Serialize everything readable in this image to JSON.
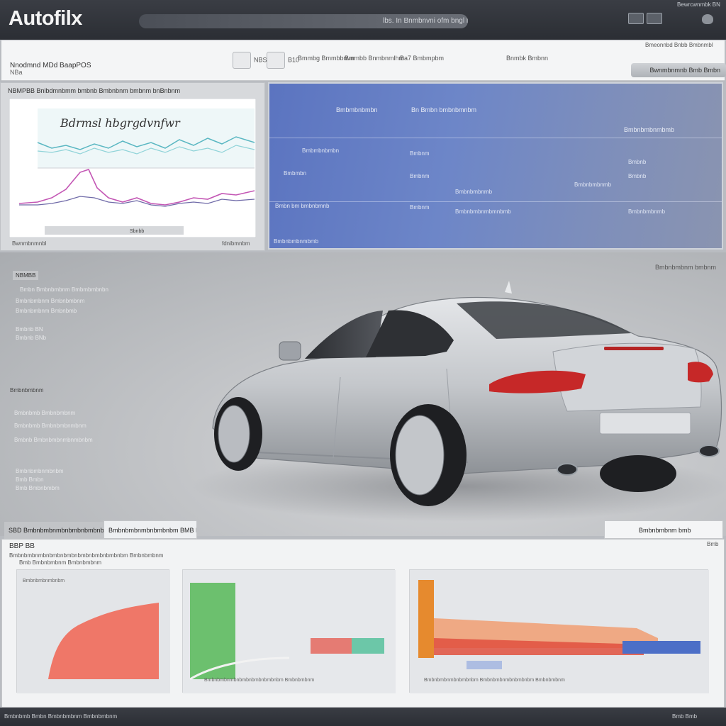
{
  "app": {
    "logo": "Autofilx",
    "search_text": "lbs. In Bnmbnvni ofm bngl hnmf",
    "top_right": "Bewrcwnmbk BN"
  },
  "subheader": {
    "title": "Nnodmnd MDd BaapPOS",
    "subtitle": "NBa",
    "groups": [
      {
        "label": "NBSS"
      },
      {
        "label": "B10"
      },
      {
        "label": "Bmmbg Bmmbbnvm"
      },
      {
        "label": "Bmmbb Bnmbnmlhm"
      },
      {
        "label": "Ba7 Bmbmpbm"
      },
      {
        "label": "Bnmbk Bmbnn"
      }
    ],
    "right_text": "Bmeonnbd Bnbb Bmbnmbl",
    "button": "Bwnmbnmnb Bmb Bmbn"
  },
  "left_panel": {
    "title": "NBMPBB Bnlbdmnbmm bmbnb Bmbnbnm bmbnm bnBnbnm",
    "chart_title": "Bdrmsl hbgrgdvnfwr",
    "tab": "Sbnbb",
    "footer_left": "Bwnmbnmnbl",
    "footer_right": "fdnibmnbm"
  },
  "right_panel": {
    "headers": [
      "Bmbmbnbmbn",
      "Bn Bmbn bmbnbmnbm",
      "Bmbnbmbnmbmb"
    ],
    "rows": [
      [
        "Bmbmbnbmbn",
        "Bmbnm",
        "Bmbnbmbnmb",
        "Bmbnb"
      ],
      [
        "Bmbmbn",
        "Bmbnm",
        "Bmbnbmbnmb",
        "Bmbnb"
      ],
      [
        "Bmbn bm bmbnbmnb",
        "Bmbnm",
        "Bmbnbmbnmbmnbmb",
        "Bmbnbmbnmb"
      ]
    ],
    "footer": "Bmbnbmbnmbmb"
  },
  "car_info": {
    "label_top": "NBMBB",
    "lines_a": [
      "Bmbn Bmbnbmbnm Bmbmbmbnbn",
      "Bmbnbmbnm Bmbnbmbnm",
      "Bmbnbmbnm Bmbnbmb",
      "Bmbnb BN",
      "Bmbnb BNb"
    ],
    "label_mid": "Bmbnbmbnm",
    "lines_b": [
      "Bmbnbmb Bmbnbmbnm",
      "Bmbnbmb Bmbnbmbnmbnm",
      "Bmbnb Bmbnbmbnmbnmbnbm"
    ],
    "lines_c": [
      "Bmbnbmbnmbnbm",
      "Bmb Bmbn",
      "Bmb Bmbnbmbm"
    ],
    "right_label": "Bmbnbmbnm bmbnm"
  },
  "bottom": {
    "tab1": "SBD Bmbnbmbnmbnbmbnbmbnbmbnbm",
    "tab2": "Bmbnbmbnmbnbmbnbm BMB BBB",
    "tab3": "Bmbnbmbnm bmb",
    "title": "BBP BB",
    "sub": "Bmbnbmbnmbnbmbnbmbnbmbnbmbnbmbnbm Bmbnbmbnm",
    "sub2": "Bmb Bmbnbmbnm Bmbnbmbnm",
    "right": "Bmb",
    "chart_labels": [
      "Bmbnbmbnmbnbm",
      "Bmbnbmbnmbnbmbnbmbnbmbnbm Bmbnbmbnm",
      "Bmbnbmbnmbnbmbnbm Bmbnbmbnmbnbmbnbm Bmbnbmbnm"
    ]
  },
  "statusbar": {
    "left": "Bmbnbmb Bmbn Bmbnbmbnm Bmbnbmbnm",
    "right": "Bmb Bmb"
  },
  "colors": {
    "titlebar": "#2f3238",
    "panel_blue": "#6d86c8",
    "car_body": "#c9ccd1",
    "taillight": "#c62828"
  }
}
